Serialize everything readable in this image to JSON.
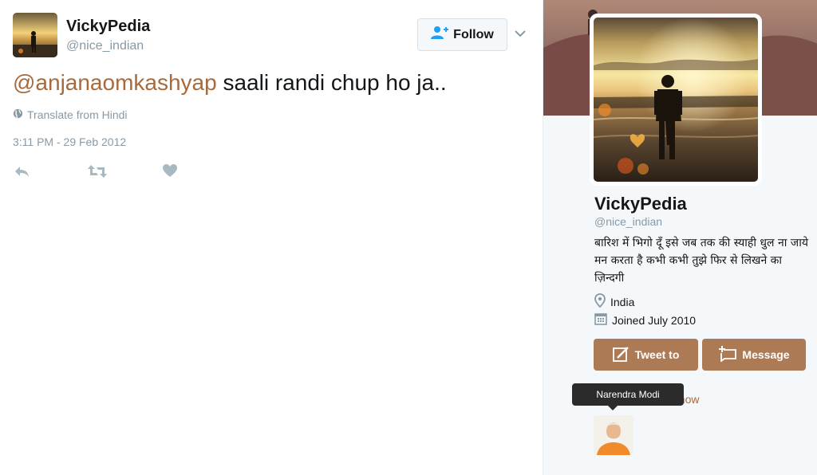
{
  "tweet": {
    "author_name": "VickyPedia",
    "author_handle": "@nice_indian",
    "follow_label": "Follow",
    "mention": "@anjanaomkashyap",
    "text_rest": " saali randi chup ho ja..",
    "translate_label": "Translate from Hindi",
    "timestamp": "3:11 PM - 29 Feb 2012"
  },
  "profile": {
    "name": "VickyPedia",
    "handle": "@nice_indian",
    "bio": "बारिश में भिगो दूँ इसे जब तक की स्याही धुल ना जाये मन करता है कभी कभी तुझे फिर से लिखने का ज़िन्दगी",
    "location": "India",
    "joined": "Joined July 2010",
    "tweet_to_label": "Tweet to",
    "message_label": "Message",
    "follower_link_partial": "er you know",
    "tooltip": "Narendra Modi"
  },
  "colors": {
    "accent_link": "#a86a3d",
    "button_brown": "#ad7a56",
    "muted": "#8899a6"
  },
  "icons": [
    "follow-person-icon",
    "chevron-down-icon",
    "globe-icon",
    "reply-icon",
    "retweet-icon",
    "like-icon",
    "location-pin-icon",
    "calendar-icon",
    "tweet-to-icon",
    "message-icon"
  ]
}
